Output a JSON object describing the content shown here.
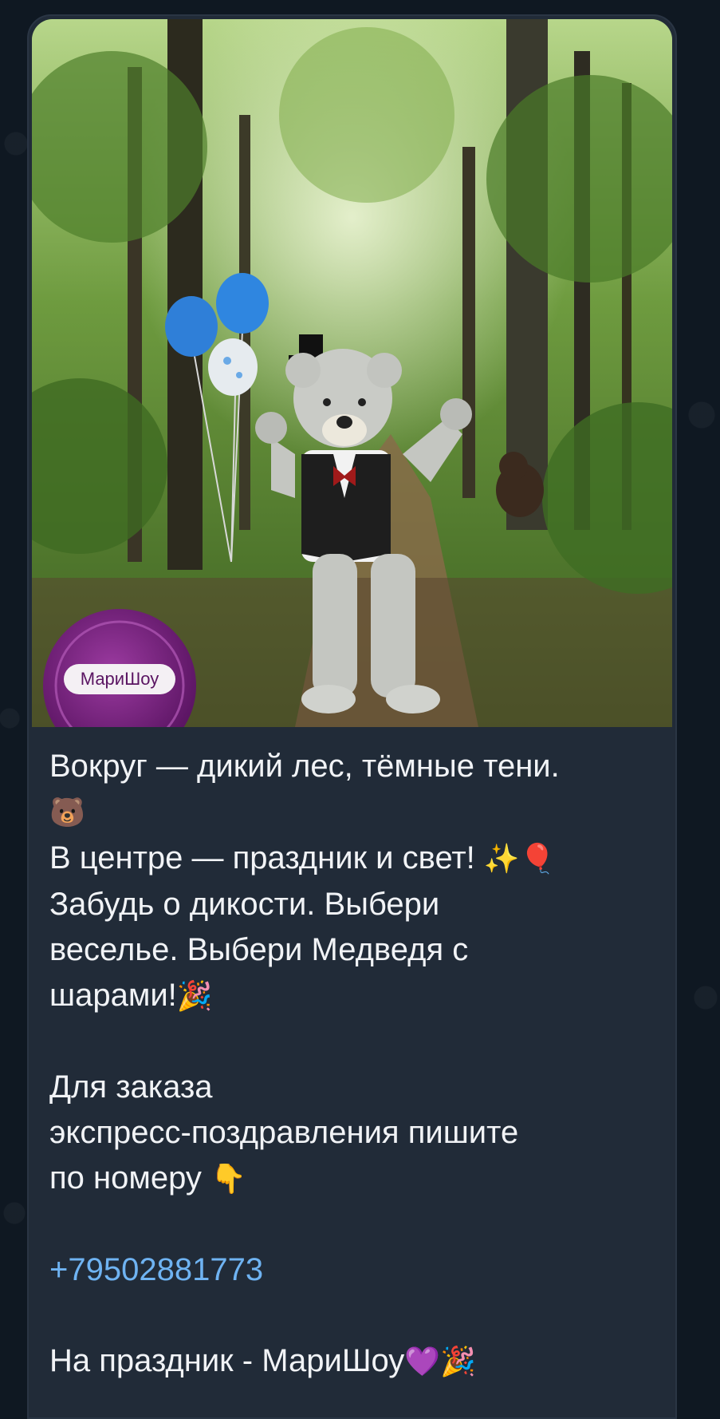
{
  "post": {
    "brand_logo_text": "МариШоу",
    "caption": {
      "line1": "Вокруг — дикий лес, тёмные тени.",
      "line2": "🐻",
      "line3_text": "В центре — праздник и свет! ",
      "line3_emoji": "✨🎈",
      "line4": "Забудь о дикости. Выбери",
      "line5": "веселье. Выбери Медведя с",
      "line6_text": "шарами!",
      "line6_emoji": "🎉",
      "line7": "Для заказа",
      "line8": "экспресс-поздравления пишите",
      "line9_text": "по номеру ",
      "line9_emoji": "👇",
      "phone": "+79502881773",
      "line11_text": "На праздник - МариШоу",
      "line11_emoji": "💜🎉"
    }
  },
  "colors": {
    "background": "#0f1822",
    "bubble": "#212b38",
    "text": "#f1f3f6",
    "link": "#6fb3f2",
    "logo_purple": "#7a1f7e"
  }
}
